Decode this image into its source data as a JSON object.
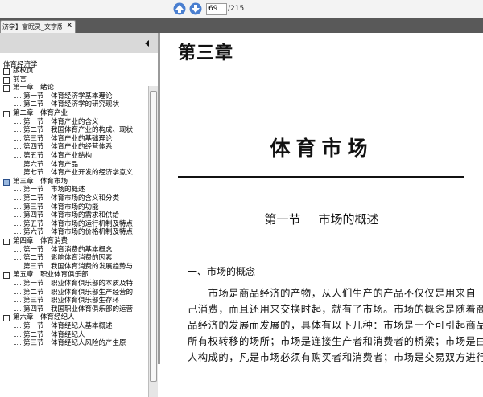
{
  "toolbar": {
    "current_page": "69",
    "page_total": "/215",
    "prev_icon": "arrow-up-icon",
    "next_icon": "arrow-down-icon",
    "icon_color": "#4a7fd0"
  },
  "tab": {
    "label": "济学】富眠灵_文字版",
    "close": "✕"
  },
  "toc": {
    "root": "体育经济学",
    "items": [
      {
        "label": "版权页",
        "level": 0
      },
      {
        "label": "前言",
        "level": 0
      },
      {
        "label": "第一章　绪论",
        "level": 0
      },
      {
        "label": "第一节　体育经济学基本理论",
        "level": 1
      },
      {
        "label": "第二节　体育经济学的研究现状",
        "level": 1
      },
      {
        "label": "第二章　体育产业",
        "level": 0
      },
      {
        "label": "第一节　体育产业的含义",
        "level": 1
      },
      {
        "label": "第二节　我国体育产业的构成、现状",
        "level": 1
      },
      {
        "label": "第三节　体育产业的基础理论",
        "level": 1
      },
      {
        "label": "第四节　体育产业的经营体系",
        "level": 1
      },
      {
        "label": "第五节　体育产业结构",
        "level": 1
      },
      {
        "label": "第六节　体育产品",
        "level": 1
      },
      {
        "label": "第七节　体育产业开发的经济学意义",
        "level": 1
      },
      {
        "label": "第三章　体育市场",
        "level": 0,
        "expanded": true
      },
      {
        "label": "第一节　市场的概述",
        "level": 1
      },
      {
        "label": "第二节　体育市场的含义和分类",
        "level": 1
      },
      {
        "label": "第三节　体育市场的功能",
        "level": 1
      },
      {
        "label": "第四节　体育市场的需求和供给",
        "level": 1
      },
      {
        "label": "第五节　体育市场的运行机制及特点",
        "level": 1
      },
      {
        "label": "第六节　体育市场的价格机制及特点",
        "level": 1
      },
      {
        "label": "第四章　体育消费",
        "level": 0
      },
      {
        "label": "第一节　体育消费的基本概念",
        "level": 1
      },
      {
        "label": "第二节　影响体育消费的因素",
        "level": 1
      },
      {
        "label": "第三节　我国体育消费的发展趋势与",
        "level": 1
      },
      {
        "label": "第五章　职业体育俱乐部",
        "level": 0
      },
      {
        "label": "第一节　职业体育俱乐部的本质及特",
        "level": 1
      },
      {
        "label": "第二节　职业体育俱乐部生产经营的",
        "level": 1
      },
      {
        "label": "第三节　职业体育俱乐部生存环",
        "level": 1
      },
      {
        "label": "第四节　我国职业体育俱乐部的运营",
        "level": 1
      },
      {
        "label": "第六章　体育经纪人",
        "level": 0
      },
      {
        "label": "第一节　体育经纪人基本概述",
        "level": 1
      },
      {
        "label": "第二节　体育经纪人",
        "level": 1
      },
      {
        "label": "第三节　体育经纪人风险的产生原",
        "level": 1
      }
    ]
  },
  "document": {
    "chapter_head": "第三章",
    "part_title": "体育市场",
    "section_number": "第一节",
    "section_name": "市场的概述",
    "subheading": "一、市场的概念",
    "paragraph_lines": [
      "　　市场是商品经济的产物，从人们生产的产品不仅仅是用来自",
      "己消费，而且还用来交换时起，就有了市场。市场的概念是随着商",
      "品经济的发展而发展的，具体有以下几种：市场是一个可引起商品",
      "所有权转移的场所；市场是连接生产者和消费者的桥梁；市场是由",
      "人构成的，凡是市场必须有购买者和消费者；市场是交易双方进行"
    ]
  }
}
